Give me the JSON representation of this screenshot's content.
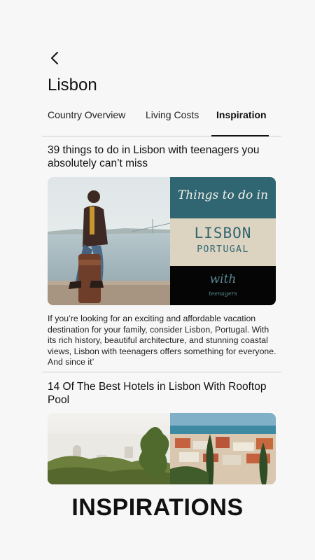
{
  "header": {
    "back_icon": "chevron-left-icon",
    "title": "Lisbon"
  },
  "tabs": [
    {
      "label": "Country Overview",
      "active": false
    },
    {
      "label": "Living Costs",
      "active": false
    },
    {
      "label": "Inspiration",
      "active": true
    }
  ],
  "articles": [
    {
      "title": "39 things to do in Lisbon with teenagers you absolutely can’t miss",
      "image_text": {
        "line1": "Things to do in",
        "line2": "LISBON",
        "line3": "PORTUGAL",
        "line4": "with",
        "line5": "teenagers"
      },
      "excerpt": "If you’re looking for an exciting and affordable vacation destination for your family, consider Lisbon, Portugal. With its rich history, beautiful architecture, and stunning coastal views, Lisbon with teenagers offers something for everyone. And since it’"
    },
    {
      "title": "14 Of The Best Hotels in Lisbon With Rooftop Pool"
    }
  ],
  "colors": {
    "accent_teal": "#2f6671",
    "beige": "#dcd3c1",
    "background": "#f7f7f7"
  },
  "footer": {
    "caption": "INSPIRATIONS"
  }
}
